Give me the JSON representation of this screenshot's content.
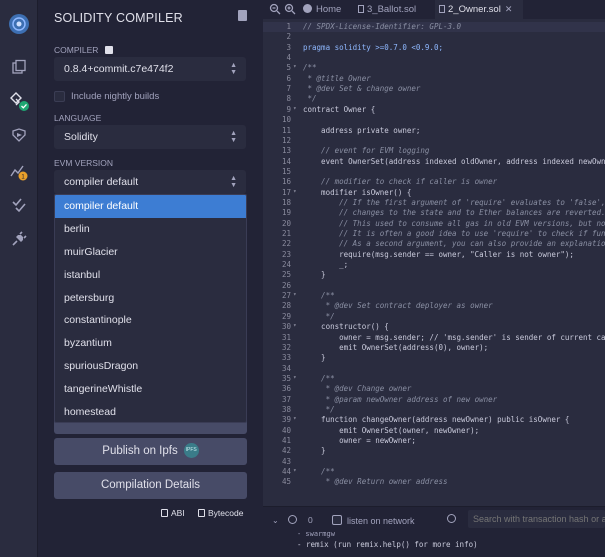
{
  "compiler_panel": {
    "title": "SOLIDITY COMPILER",
    "compiler_label": "COMPILER",
    "compiler_value": "0.8.4+commit.c7e474f2",
    "nightly_label": "Include nightly builds",
    "language_label": "LANGUAGE",
    "language_value": "Solidity",
    "evm_label": "EVM VERSION",
    "evm_value": "compiler default",
    "evm_options": [
      "compiler default",
      "berlin",
      "muirGlacier",
      "istanbul",
      "petersburg",
      "constantinople",
      "byzantium",
      "spuriousDragon",
      "tangerineWhistle",
      "homestead"
    ],
    "publish_label": "Publish on Ipfs",
    "ipfs_badge": "IPFS",
    "details_label": "Compilation Details",
    "abi_label": "ABI",
    "bytecode_label": "Bytecode"
  },
  "editor": {
    "tabs": [
      {
        "label": "Home",
        "icon": "remix-logo-icon",
        "active": false
      },
      {
        "label": "3_Ballot.sol",
        "icon": "file-icon",
        "active": false
      },
      {
        "label": "2_Owner.sol",
        "icon": "file-icon",
        "active": true
      }
    ],
    "lines": [
      {
        "n": "1",
        "text": "// SPDX-License-Identifier: GPL-3.0",
        "kind": "comment",
        "fold": false,
        "highlight": true
      },
      {
        "n": "2",
        "text": "",
        "kind": "plain",
        "fold": false,
        "highlight": false
      },
      {
        "n": "3",
        "text": "pragma solidity >=0.7.0 <0.9.0;",
        "kind": "keyword",
        "fold": false,
        "highlight": false
      },
      {
        "n": "4",
        "text": "",
        "kind": "plain",
        "fold": false,
        "highlight": false
      },
      {
        "n": "5",
        "text": "/**",
        "kind": "comment",
        "fold": true,
        "highlight": false
      },
      {
        "n": "6",
        "text": " * @title Owner",
        "kind": "comment",
        "fold": false,
        "highlight": false
      },
      {
        "n": "7",
        "text": " * @dev Set & change owner",
        "kind": "comment",
        "fold": false,
        "highlight": false
      },
      {
        "n": "8",
        "text": " */",
        "kind": "comment",
        "fold": false,
        "highlight": false
      },
      {
        "n": "9",
        "text": "contract Owner {",
        "kind": "plain",
        "fold": true,
        "highlight": false
      },
      {
        "n": "10",
        "text": "",
        "kind": "plain",
        "fold": false,
        "highlight": false
      },
      {
        "n": "11",
        "text": "    address private owner;",
        "kind": "plain",
        "fold": false,
        "highlight": false
      },
      {
        "n": "12",
        "text": "",
        "kind": "plain",
        "fold": false,
        "highlight": false
      },
      {
        "n": "13",
        "text": "    // event for EVM logging",
        "kind": "comment",
        "fold": false,
        "highlight": false
      },
      {
        "n": "14",
        "text": "    event OwnerSet(address indexed oldOwner, address indexed newOwner);",
        "kind": "plain",
        "fold": false,
        "highlight": false
      },
      {
        "n": "15",
        "text": "",
        "kind": "plain",
        "fold": false,
        "highlight": false
      },
      {
        "n": "16",
        "text": "    // modifier to check if caller is owner",
        "kind": "comment",
        "fold": false,
        "highlight": false
      },
      {
        "n": "17",
        "text": "    modifier isOwner() {",
        "kind": "plain",
        "fold": true,
        "highlight": false
      },
      {
        "n": "18",
        "text": "        // If the first argument of 'require' evaluates to 'false', execution terminates and all",
        "kind": "comment",
        "fold": false,
        "highlight": false
      },
      {
        "n": "19",
        "text": "        // changes to the state and to Ether balances are reverted.",
        "kind": "comment",
        "fold": false,
        "highlight": false
      },
      {
        "n": "20",
        "text": "        // This used to consume all gas in old EVM versions, but not anymore.",
        "kind": "comment",
        "fold": false,
        "highlight": false
      },
      {
        "n": "21",
        "text": "        // It is often a good idea to use 'require' to check if functions are called correctly.",
        "kind": "comment",
        "fold": false,
        "highlight": false
      },
      {
        "n": "22",
        "text": "        // As a second argument, you can also provide an explanation about what went wrong.",
        "kind": "comment",
        "fold": false,
        "highlight": false
      },
      {
        "n": "23",
        "text": "        require(msg.sender == owner, \"Caller is not owner\");",
        "kind": "plain",
        "fold": false,
        "highlight": false
      },
      {
        "n": "24",
        "text": "        _;",
        "kind": "plain",
        "fold": false,
        "highlight": false
      },
      {
        "n": "25",
        "text": "    }",
        "kind": "plain",
        "fold": false,
        "highlight": false
      },
      {
        "n": "26",
        "text": "",
        "kind": "plain",
        "fold": false,
        "highlight": false
      },
      {
        "n": "27",
        "text": "    /**",
        "kind": "comment",
        "fold": true,
        "highlight": false
      },
      {
        "n": "28",
        "text": "     * @dev Set contract deployer as owner",
        "kind": "comment",
        "fold": false,
        "highlight": false
      },
      {
        "n": "29",
        "text": "     */",
        "kind": "comment",
        "fold": false,
        "highlight": false
      },
      {
        "n": "30",
        "text": "    constructor() {",
        "kind": "plain",
        "fold": true,
        "highlight": false
      },
      {
        "n": "31",
        "text": "        owner = msg.sender; // 'msg.sender' is sender of current call, contract deployer for a constructor",
        "kind": "plain",
        "fold": false,
        "highlight": false
      },
      {
        "n": "32",
        "text": "        emit OwnerSet(address(0), owner);",
        "kind": "plain",
        "fold": false,
        "highlight": false
      },
      {
        "n": "33",
        "text": "    }",
        "kind": "plain",
        "fold": false,
        "highlight": false
      },
      {
        "n": "34",
        "text": "",
        "kind": "plain",
        "fold": false,
        "highlight": false
      },
      {
        "n": "35",
        "text": "    /**",
        "kind": "comment",
        "fold": true,
        "highlight": false
      },
      {
        "n": "36",
        "text": "     * @dev Change owner",
        "kind": "comment",
        "fold": false,
        "highlight": false
      },
      {
        "n": "37",
        "text": "     * @param newOwner address of new owner",
        "kind": "comment",
        "fold": false,
        "highlight": false
      },
      {
        "n": "38",
        "text": "     */",
        "kind": "comment",
        "fold": false,
        "highlight": false
      },
      {
        "n": "39",
        "text": "    function changeOwner(address newOwner) public isOwner {",
        "kind": "plain",
        "fold": true,
        "highlight": false
      },
      {
        "n": "40",
        "text": "        emit OwnerSet(owner, newOwner);",
        "kind": "plain",
        "fold": false,
        "highlight": false
      },
      {
        "n": "41",
        "text": "        owner = newOwner;",
        "kind": "plain",
        "fold": false,
        "highlight": false
      },
      {
        "n": "42",
        "text": "    }",
        "kind": "plain",
        "fold": false,
        "highlight": false
      },
      {
        "n": "43",
        "text": "",
        "kind": "plain",
        "fold": false,
        "highlight": false
      },
      {
        "n": "44",
        "text": "    /**",
        "kind": "comment",
        "fold": true,
        "highlight": false
      },
      {
        "n": "45",
        "text": "     * @dev Return owner address",
        "kind": "comment",
        "fold": false,
        "highlight": false
      }
    ]
  },
  "terminal": {
    "count": "0",
    "listen_label": "listen on network",
    "search_placeholder": "Search with transaction hash or address",
    "line1": "- swarmgw",
    "line2": "- remix (run remix.help() for more info)"
  },
  "colors": {
    "accent": "#3d7dd3",
    "panel_bg": "#222336",
    "editor_bg": "#2a2c3f",
    "button_bg": "#474b67",
    "compile_ok": "#1ea672",
    "warning_badge": "#e8a02b"
  },
  "rail_icons": [
    "remix-logo-icon",
    "file-explorer-icon",
    "solidity-compiler-icon",
    "deploy-run-icon",
    "analysis-icon",
    "unit-test-icon",
    "plugin-manager-icon"
  ]
}
